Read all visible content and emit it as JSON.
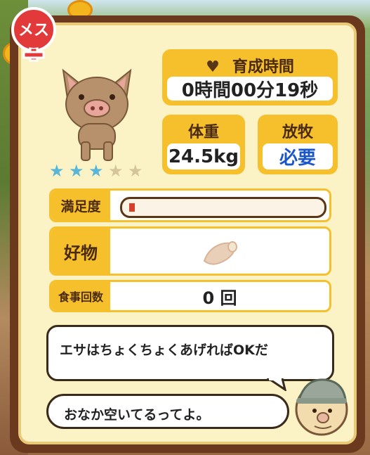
{
  "gender_badge": "メス",
  "rating": {
    "filled": 3,
    "total": 5
  },
  "growth_time": {
    "label": "育成時間",
    "value": "0時間00分19秒"
  },
  "weight": {
    "label": "体重",
    "value": "24.5kg"
  },
  "grazing": {
    "label": "放牧",
    "value": "必要"
  },
  "satisfaction": {
    "label": "満足度",
    "level": 0.03
  },
  "favorite": {
    "label": "好物",
    "icon": "sweet-potato-icon"
  },
  "meal_count": {
    "label": "食事回数",
    "value": "0 回"
  },
  "dialog": {
    "tip": "エサはちょくちょくあげればOKだ",
    "status": "おなか空いてるってよ。"
  },
  "colors": {
    "accent": "#f6c02c",
    "panel": "#fbf3c6",
    "frame": "#6b3a1e",
    "value_blue": "#1a56c9"
  }
}
